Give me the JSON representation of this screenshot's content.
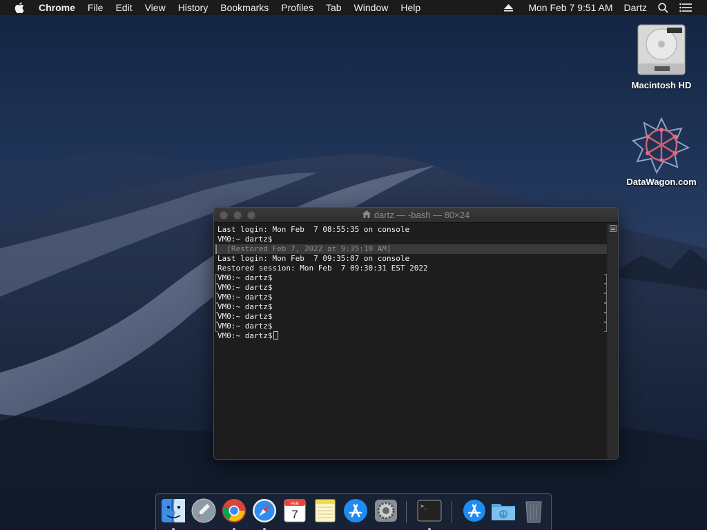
{
  "menubar": {
    "app_name": "Chrome",
    "items": [
      "File",
      "Edit",
      "View",
      "History",
      "Bookmarks",
      "Profiles",
      "Tab",
      "Window",
      "Help"
    ],
    "datetime": "Mon Feb 7  9:51 AM",
    "user": "Dartz"
  },
  "desktop": {
    "icons": [
      {
        "label": "Macintosh HD",
        "icon": "hard-drive-icon"
      },
      {
        "label": "DataWagon.com",
        "icon": "datawagon-icon"
      }
    ]
  },
  "terminal": {
    "title": "dartz — -bash — 80×24",
    "lines": [
      "Last login: Mon Feb  7 08:55:35 on console",
      "VM0:~ dartz$",
      "  [Restored Feb 7, 2022 at 9:35:10 AM]",
      "Last login: Mon Feb  7 09:35:07 on console",
      "Restored session: Mon Feb  7 09:30:31 EST 2022",
      "VM0:~ dartz$",
      "VM0:~ dartz$",
      "VM0:~ dartz$",
      "VM0:~ dartz$",
      "VM0:~ dartz$",
      "VM0:~ dartz$"
    ],
    "prompt": "VM0:~ dartz$"
  },
  "dock": {
    "apps": [
      {
        "name": "Finder",
        "icon": "finder-icon"
      },
      {
        "name": "Launchpad",
        "icon": "launchpad-icon"
      },
      {
        "name": "Google Chrome",
        "icon": "chrome-icon"
      },
      {
        "name": "Safari",
        "icon": "safari-icon"
      },
      {
        "name": "Calendar",
        "icon": "calendar-icon",
        "month": "FEB",
        "day": "7"
      },
      {
        "name": "Notes",
        "icon": "notes-icon"
      },
      {
        "name": "App Store",
        "icon": "app-store-icon"
      },
      {
        "name": "System Preferences",
        "icon": "system-preferences-icon"
      },
      {
        "name": "Terminal",
        "icon": "terminal-icon",
        "glyph": ">_"
      },
      {
        "name": "Applications",
        "icon": "applications-folder-icon"
      },
      {
        "name": "Downloads",
        "icon": "downloads-folder-icon"
      },
      {
        "name": "Trash",
        "icon": "trash-icon"
      }
    ]
  }
}
